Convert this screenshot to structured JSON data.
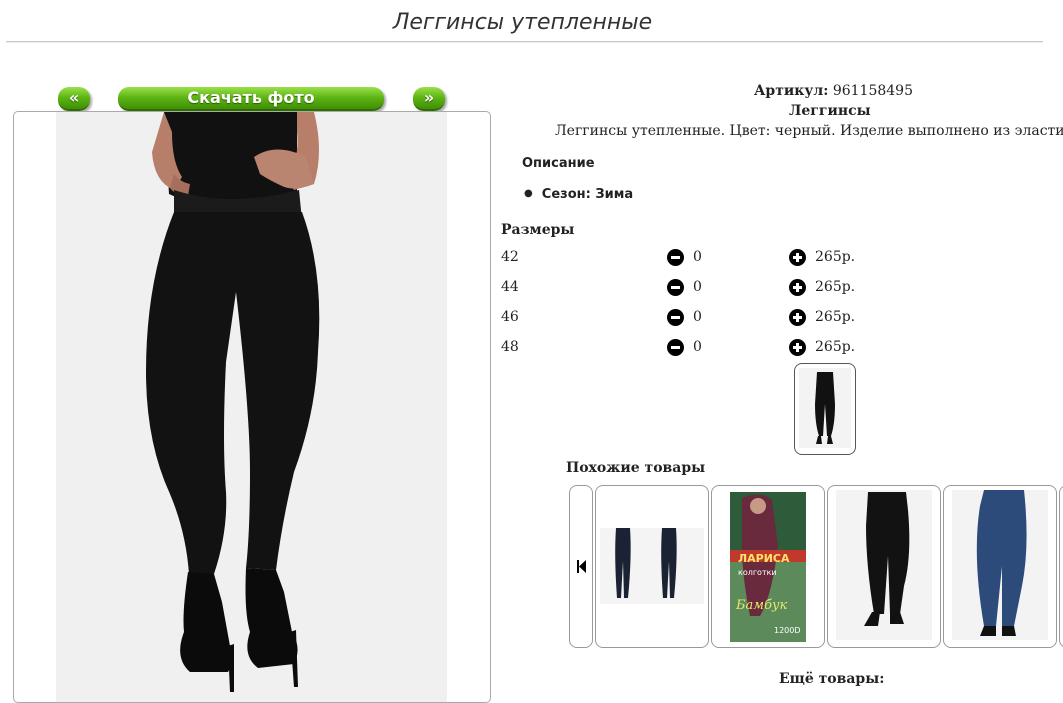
{
  "page": {
    "title": "Леггинсы утепленные"
  },
  "gallery": {
    "prev_label": "«",
    "download_label": "Скачать фото",
    "next_label": "»"
  },
  "product": {
    "article_label": "Артикул:",
    "article_value": "961158495",
    "category": "Леггинсы",
    "description_text": "Леггинсы утепленные. Цвет: черный. Изделие выполнено из эластичной т",
    "description_heading": "Описание",
    "season_item": "Сезон: Зима"
  },
  "sizes": {
    "heading": "Размеры",
    "rows": [
      {
        "size": "42",
        "qty": "0",
        "price": "265р."
      },
      {
        "size": "44",
        "qty": "0",
        "price": "265р."
      },
      {
        "size": "46",
        "qty": "0",
        "price": "265р."
      },
      {
        "size": "48",
        "qty": "0",
        "price": "265р."
      }
    ]
  },
  "similar": {
    "heading": "Похожие товары",
    "prev_icon": "skip-back-icon",
    "packaging": {
      "brand": "ЛАРИСА",
      "line1": "колготки",
      "line2": "Бамбук",
      "density": "1200D"
    }
  },
  "more": {
    "heading": "Ещё товары:"
  },
  "colors": {
    "accent_green": "#5cb313",
    "leggings_black": "#111111",
    "denim_blue": "#2c4a7a"
  }
}
